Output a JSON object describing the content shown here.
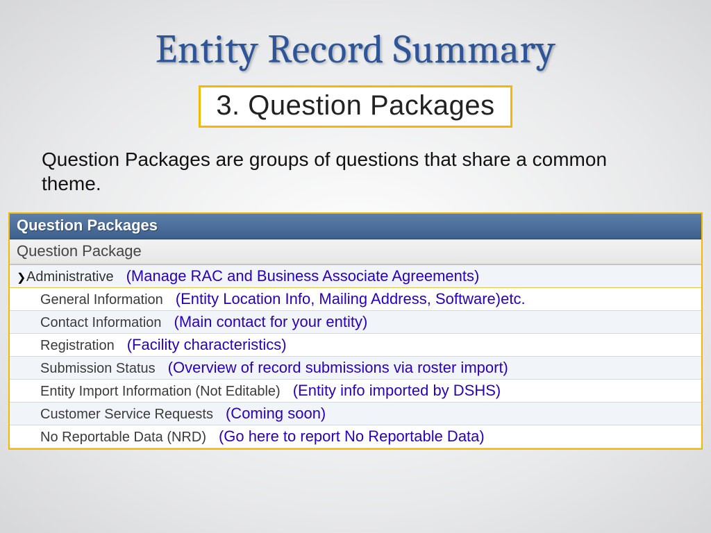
{
  "title": "Entity Record Summary",
  "subtitle": "3. Question Packages",
  "lead": "Question Packages are groups of questions that share a common theme.",
  "panel": {
    "heading": "Question Packages",
    "column_header": "Question Package",
    "rows": [
      {
        "label": "Administrative",
        "desc": "(Manage RAC and Business Associate Agreements)",
        "selected": true,
        "indent": false
      },
      {
        "label": "General Information",
        "desc": "(Entity Location Info, Mailing Address, Software)etc.",
        "selected": false,
        "indent": true
      },
      {
        "label": "Contact Information",
        "desc": "(Main contact for your entity)",
        "selected": false,
        "indent": true
      },
      {
        "label": "Registration",
        "desc": "(Facility characteristics)",
        "selected": false,
        "indent": true
      },
      {
        "label": "Submission Status",
        "desc": "(Overview of record submissions via roster import)",
        "selected": false,
        "indent": true
      },
      {
        "label": "Entity Import Information (Not Editable)",
        "desc": "(Entity info imported by DSHS)",
        "selected": false,
        "indent": true
      },
      {
        "label": "Customer Service Requests",
        "desc": "(Coming soon)",
        "selected": false,
        "indent": true
      },
      {
        "label": "No Reportable Data (NRD)",
        "desc": "(Go here to report No Reportable Data)",
        "selected": false,
        "indent": true
      }
    ]
  }
}
